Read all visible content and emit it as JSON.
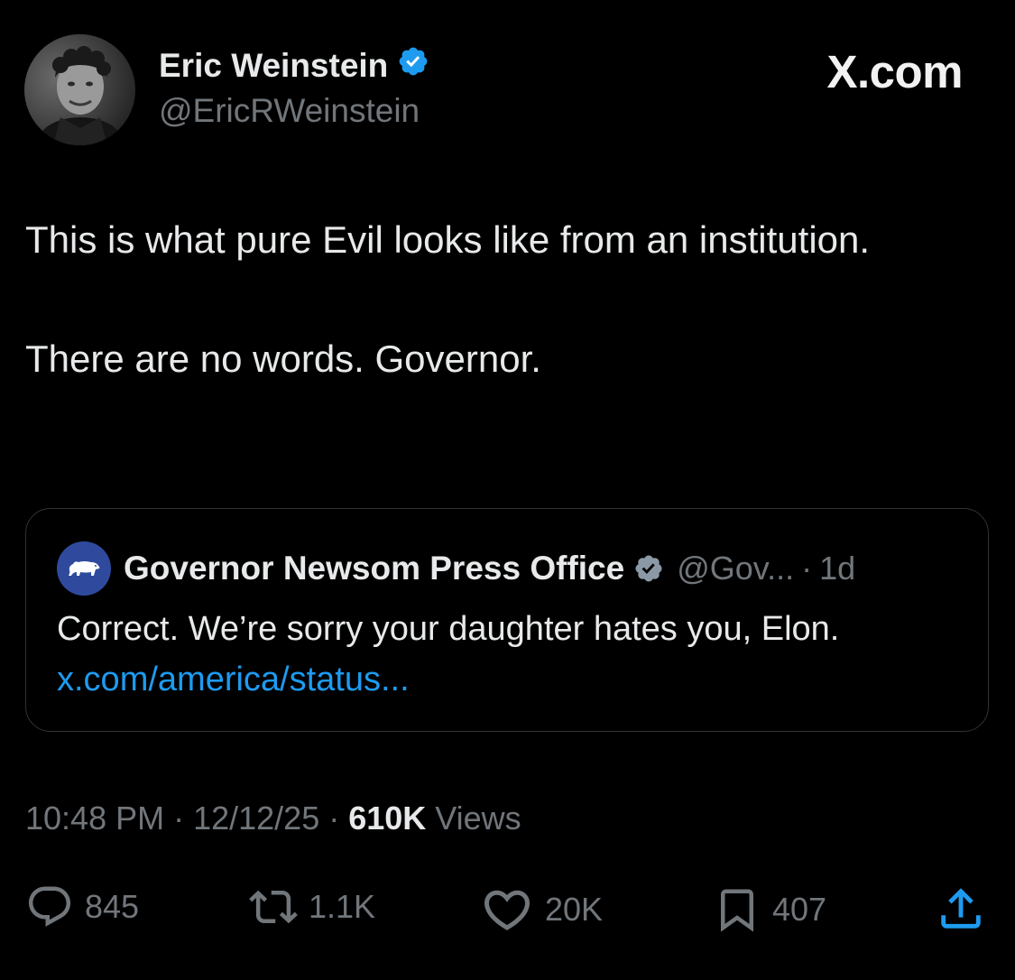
{
  "author": {
    "display_name": "Eric Weinstein",
    "handle": "@EricRWeinstein",
    "verified": true,
    "avatar_icon": "profile-photo"
  },
  "brand": "X.com",
  "tweet": {
    "paragraph1": "This is what pure Evil looks like from an institution.",
    "paragraph2": "There are no words. Governor."
  },
  "quoted_tweet": {
    "display_name": "Governor Newsom Press Office",
    "handle": "@Gov...",
    "separator": "·",
    "time": "1d",
    "text": "Correct. We’re sorry your daughter hates you, Elon.",
    "link": "x.com/america/status...",
    "avatar_icon": "california-bear-icon"
  },
  "meta": {
    "time": "10:48 PM",
    "date": "12/12/25",
    "separator": "·",
    "views_count": "610K",
    "views_label": "Views"
  },
  "actions": {
    "replies": "845",
    "reposts": "1.1K",
    "likes": "20K",
    "bookmarks": "407"
  },
  "colors": {
    "background": "#000000",
    "text_primary": "#e7e9ea",
    "text_secondary": "#71767b",
    "link": "#1d9bf0",
    "verified_badge": "#1d9bf0",
    "border": "#2f3336"
  }
}
